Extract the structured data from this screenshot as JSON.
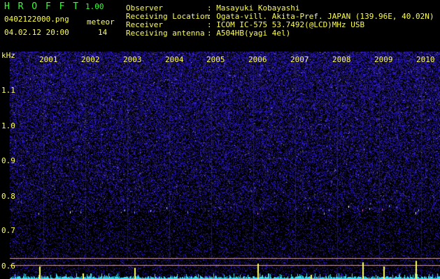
{
  "header": {
    "app_name": "H R O F F T",
    "version": "1.00",
    "filename": "0402122000.png",
    "datetime": "04.02.12 20:00",
    "meteor_label": "meteor",
    "meteor_count": "14"
  },
  "info": {
    "observer_label": "Observer",
    "observer_value": ": Masayuki Kobayashi",
    "location_label": "Receiving Location",
    "location_value": ": Ogata-vill. Akita-Pref. JAPAN (139.96E, 40.02N)",
    "receiver_label": "Receiver",
    "receiver_value": ": ICOM IC-575 53.7492(@LCD)MHz USB",
    "antenna_label": "Receiving antenna",
    "antenna_value": ": A504HB(yagi 4el)"
  },
  "axes": {
    "y_unit": "kHz",
    "y_ticks": [
      "1.1",
      "1.0",
      "0.9",
      "0.8",
      "0.7",
      "0.6"
    ],
    "x_ticks": [
      "2001",
      "2002",
      "2003",
      "2004",
      "2005",
      "2006",
      "2007",
      "2008",
      "2009",
      "2010"
    ]
  },
  "colors": {
    "background": "#000000",
    "text_green": "#33ff33",
    "text_yellow": "#ffff4d",
    "noise_blue": "#2828c8",
    "echo_yellow": "#ffff60",
    "baseline_cyan": "#40e0f0"
  }
}
